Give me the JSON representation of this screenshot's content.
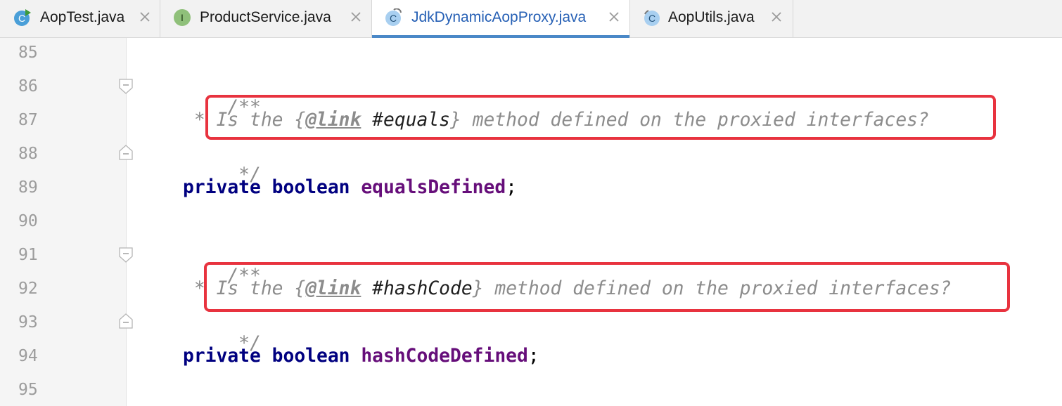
{
  "tabs": [
    {
      "label": "AopTest.java",
      "icon": "class-runnable-icon",
      "active": false
    },
    {
      "label": "ProductService.java",
      "icon": "interface-icon",
      "active": false
    },
    {
      "label": "JdkDynamicAopProxy.java",
      "icon": "class-icon",
      "active": true
    },
    {
      "label": "AopUtils.java",
      "icon": "class-icon",
      "active": false
    }
  ],
  "editor": {
    "line_numbers": [
      "85",
      "86",
      "87",
      "88",
      "89",
      "90",
      "91",
      "92",
      "93",
      "94",
      "95"
    ],
    "comment1": {
      "open": "/**",
      "star": " *",
      "text_pre": " Is the ",
      "brace_open": "{",
      "tag": "@link",
      "ref": " #equals",
      "brace_close": "}",
      "text_post": " method defined on the proxied interfaces?",
      "close": " */"
    },
    "field1": {
      "kw1": "private",
      "kw2": "boolean",
      "name": "equalsDefined",
      "semi": ";"
    },
    "comment2": {
      "open": "/**",
      "star": " *",
      "text_pre": " Is the ",
      "brace_open": "{",
      "tag": "@link",
      "ref": " #hashCode",
      "brace_close": "}",
      "text_post": " method defined on the proxied interfaces?",
      "close": " */"
    },
    "field2": {
      "kw1": "private",
      "kw2": "boolean",
      "name": "hashCodeDefined",
      "semi": ";"
    }
  },
  "colors": {
    "keyword": "#000080",
    "field": "#660e7a",
    "doc_comment": "#8c8c8c",
    "highlight": "#e8333f",
    "active_tab_underline": "#4a88c7"
  }
}
